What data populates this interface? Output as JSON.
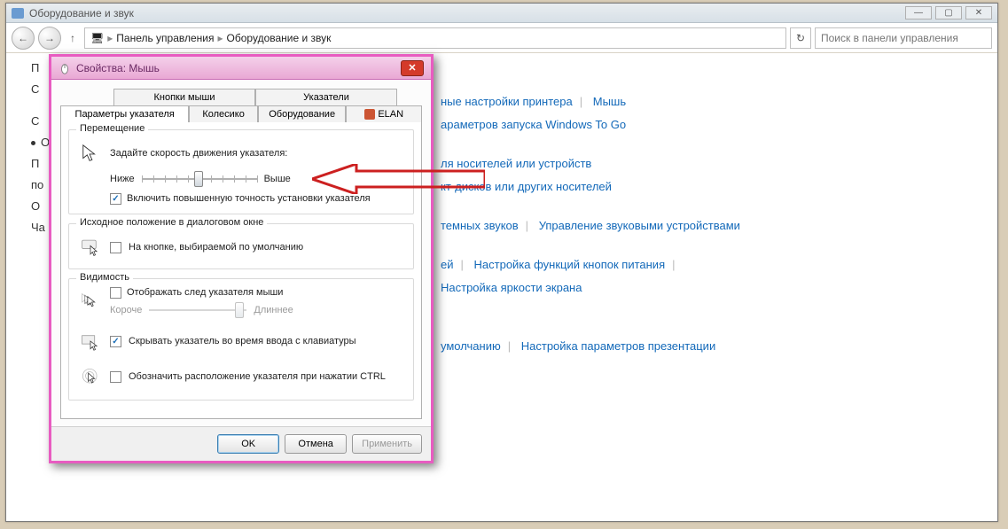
{
  "window": {
    "title": "Оборудование и звук",
    "win_min": "—",
    "win_max": "▢",
    "win_close": "✕",
    "back_arrow": "←",
    "fwd_arrow": "→",
    "up_arrow": "↑",
    "refresh": "↻",
    "breadcrumb_sep": "▸",
    "breadcrumb": {
      "root_icon": "🖥",
      "part1": "Панель управления",
      "part2": "Оборудование и звук"
    },
    "search_placeholder": "Поиск в панели управления"
  },
  "bg_left": {
    "l1": "П",
    "l2": "С",
    "l3": "С",
    "l4": "О",
    "l5": "П",
    "l6": "по",
    "l7": "О",
    "l8": "Ча"
  },
  "bg_links": {
    "r1a": "ные настройки принтера",
    "r1b": "Мышь",
    "r2a": "араметров запуска Windows To Go",
    "r3a": "ля носителей или устройств",
    "r4a": "кт-дисков или других носителей",
    "r5a": "темных звуков",
    "r5b": "Управление звуковыми устройствами",
    "r6a": "ей",
    "r6b": "Настройка функций кнопок питания",
    "r7a": "Настройка яркости экрана",
    "r8a": "умолчанию",
    "r8b": "Настройка параметров презентации"
  },
  "dialog": {
    "title": "Свойства: Мышь",
    "close_label": "✕",
    "tabs_top": {
      "buttons": "Кнопки мыши",
      "pointers": "Указатели"
    },
    "tabs_bottom": {
      "pointer_options": "Параметры указателя",
      "wheel": "Колесико",
      "hardware": "Оборудование",
      "elan": "ELAN"
    },
    "motion": {
      "group": "Перемещение",
      "label": "Задайте скорость движения указателя:",
      "slow": "Ниже",
      "fast": "Выше",
      "enhance": "Включить повышенную точность установки указателя"
    },
    "snapto": {
      "group": "Исходное положение в диалоговом окне",
      "label": "На кнопке, выбираемой по умолчанию"
    },
    "visibility": {
      "group": "Видимость",
      "trails": "Отображать след указателя мыши",
      "short": "Короче",
      "long": "Длиннее",
      "hide_typing": "Скрывать указатель во время ввода с клавиатуры",
      "ctrl_locate": "Обозначить расположение указателя при нажатии CTRL"
    },
    "buttons": {
      "ok": "OK",
      "cancel": "Отмена",
      "apply": "Применить"
    }
  }
}
